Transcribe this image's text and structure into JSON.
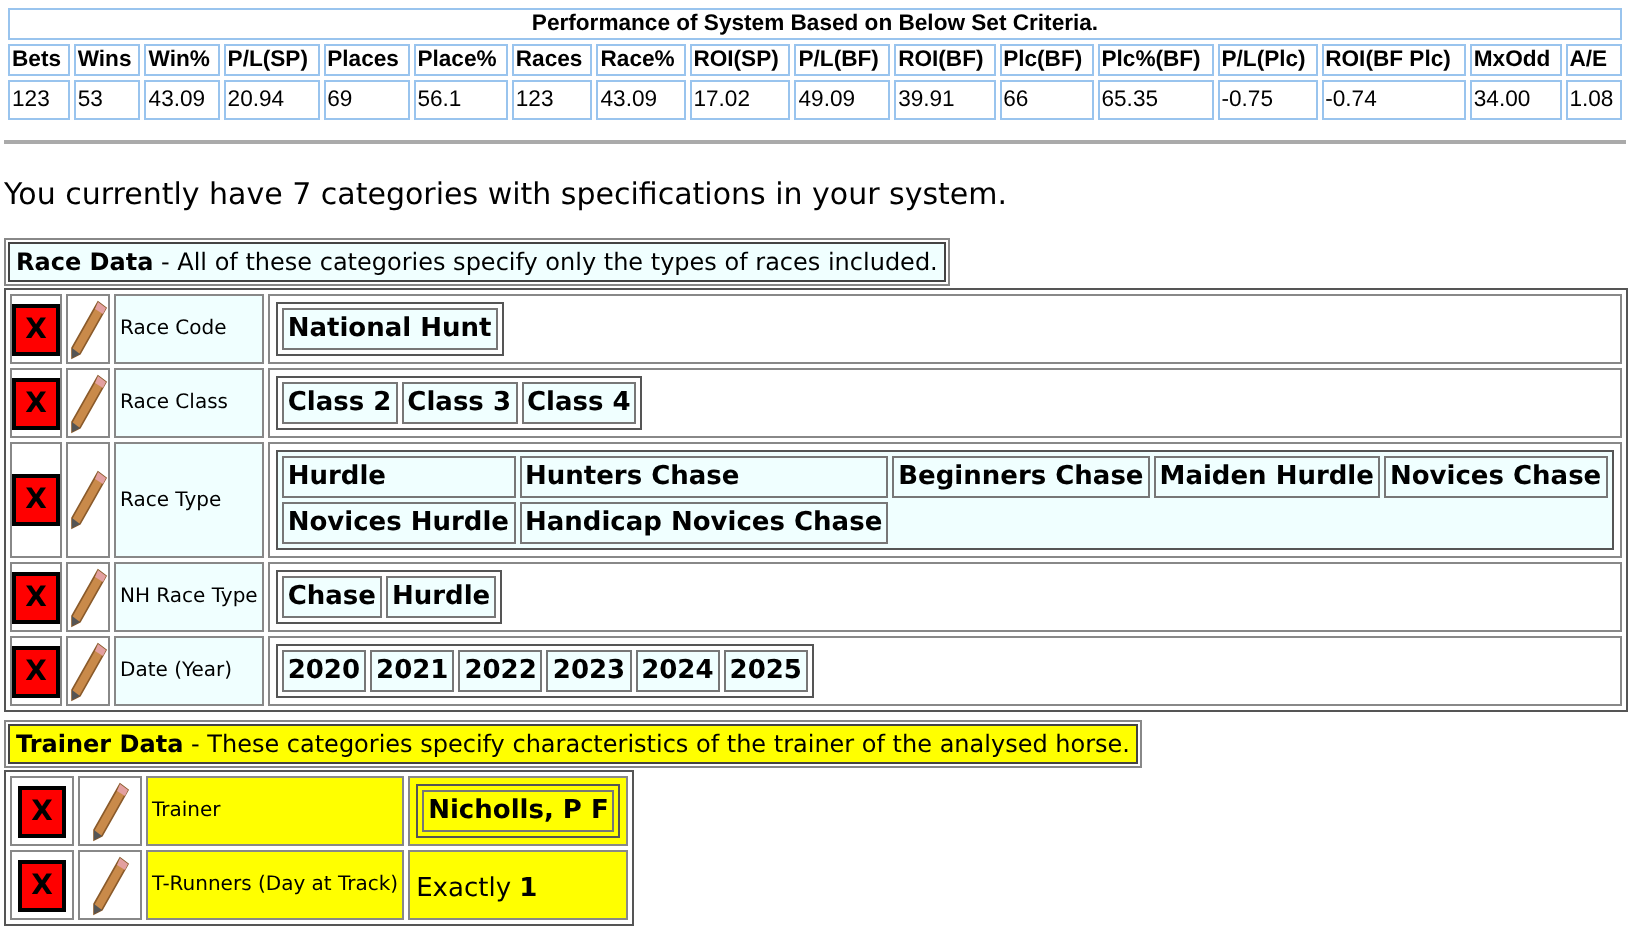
{
  "performance": {
    "title": "Performance of System Based on Below Set Criteria.",
    "columns": [
      "Bets",
      "Wins",
      "Win%",
      "P/L(SP)",
      "Places",
      "Place%",
      "Races",
      "Race%",
      "ROI(SP)",
      "P/L(BF)",
      "ROI(BF)",
      "Plc(BF)",
      "Plc%(BF)",
      "P/L(Plc)",
      "ROI(BF Plc)",
      "MxOdd",
      "A/E"
    ],
    "values": [
      "123",
      "53",
      "43.09",
      "20.94",
      "69",
      "56.1",
      "123",
      "43.09",
      "17.02",
      "49.09",
      "39.91",
      "66",
      "65.35",
      "-0.75",
      "-0.74",
      "34.00",
      "1.08"
    ]
  },
  "summary": "You currently have 7 categories with specifications in your system.",
  "sections": [
    {
      "color": "#f0ffff",
      "title": "Race Data",
      "description": " - All of these categories specify only the types of races included.",
      "criteria": [
        {
          "delete": "X",
          "label": "Race Code",
          "kind": "tags",
          "rows": [
            [
              "National Hunt"
            ]
          ]
        },
        {
          "delete": "X",
          "label": "Race Class",
          "kind": "tags",
          "rows": [
            [
              "Class 2",
              "Class 3",
              "Class 4"
            ]
          ]
        },
        {
          "delete": "X",
          "label": "Race Type",
          "kind": "tags",
          "rows": [
            [
              "Hurdle",
              "Hunters Chase",
              "Beginners Chase",
              "Maiden Hurdle",
              "Novices Chase"
            ],
            [
              "Novices Hurdle",
              "Handicap Novices Chase"
            ]
          ]
        },
        {
          "delete": "X",
          "label": "NH Race Type",
          "kind": "tags",
          "rows": [
            [
              "Chase",
              "Hurdle"
            ]
          ]
        },
        {
          "delete": "X",
          "label": "Date (Year)",
          "kind": "tags",
          "rows": [
            [
              "2020",
              "2021",
              "2022",
              "2023",
              "2024",
              "2025"
            ]
          ]
        }
      ]
    },
    {
      "color": "#ffff00",
      "title": "Trainer Data",
      "description": " - These categories specify characteristics of the trainer of the analysed horse.",
      "criteria": [
        {
          "delete": "X",
          "label": "Trainer",
          "kind": "tags",
          "rows": [
            [
              "Nicholls, P F"
            ]
          ]
        },
        {
          "delete": "X",
          "label": "T-Runners (Day at Track)",
          "kind": "text",
          "text": "Exactly **1**"
        }
      ]
    }
  ]
}
